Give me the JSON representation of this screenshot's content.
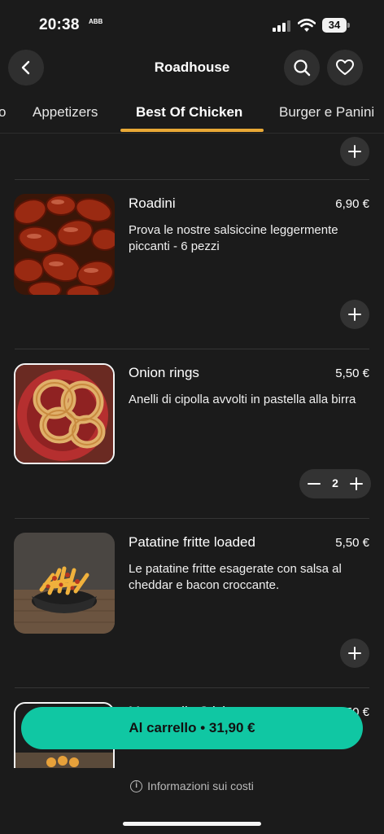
{
  "status": {
    "time": "20:38",
    "sub": "ABB",
    "battery": "34"
  },
  "header": {
    "title": "Roadhouse",
    "back_icon": "back-arrow-icon",
    "search_icon": "search-icon",
    "favorite_icon": "heart-icon"
  },
  "tabs": [
    {
      "label": "o"
    },
    {
      "label": "Appetizers"
    },
    {
      "label": "Best Of Chicken",
      "active": true
    },
    {
      "label": "Burger e Panini"
    }
  ],
  "items": [
    {
      "name": "Roadini",
      "price": "6,90 €",
      "description": "Prova le nostre salsiccine leggermente piccanti - 6 pezzi"
    },
    {
      "name": "Onion rings",
      "price": "5,50 €",
      "description": "Anelli di cipolla avvolti in pastella alla birra",
      "quantity": "2"
    },
    {
      "name": "Patatine fritte loaded",
      "price": "5,50 €",
      "description": "Le patatine fritte esagerate con salsa al cheddar e bacon croccante."
    },
    {
      "name": "Mozzarella Sticks",
      "price": "5,50 €"
    }
  ],
  "cart": {
    "label": "Al carrello • 31,90 €"
  },
  "info": {
    "label": "Informazioni sui costi"
  },
  "colors": {
    "accent": "#e8a836",
    "cart": "#10c7a3",
    "background": "#1b1b1b"
  }
}
